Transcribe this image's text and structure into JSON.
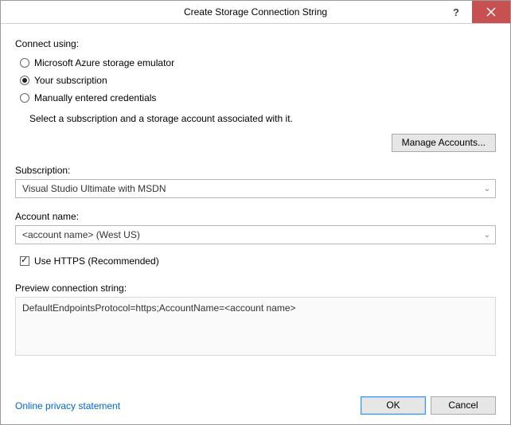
{
  "titlebar": {
    "title": "Create Storage Connection String",
    "help_label": "?",
    "close_label": "Close"
  },
  "connect": {
    "label": "Connect using:",
    "options": {
      "emulator": "Microsoft Azure storage emulator",
      "subscription": "Your subscription",
      "manual": "Manually entered credentials"
    },
    "hint": "Select a subscription and a storage account associated with it."
  },
  "manage_accounts": {
    "label": "Manage Accounts..."
  },
  "subscription": {
    "label": "Subscription:",
    "value": "Visual Studio Ultimate with MSDN"
  },
  "account": {
    "label": "Account name:",
    "value": "<account name> (West US)"
  },
  "https": {
    "label": "Use HTTPS (Recommended)"
  },
  "preview": {
    "label": "Preview connection string:",
    "value": "DefaultEndpointsProtocol=https;AccountName=<account name>"
  },
  "footer": {
    "privacy": "Online privacy statement",
    "ok": "OK",
    "cancel": "Cancel"
  }
}
